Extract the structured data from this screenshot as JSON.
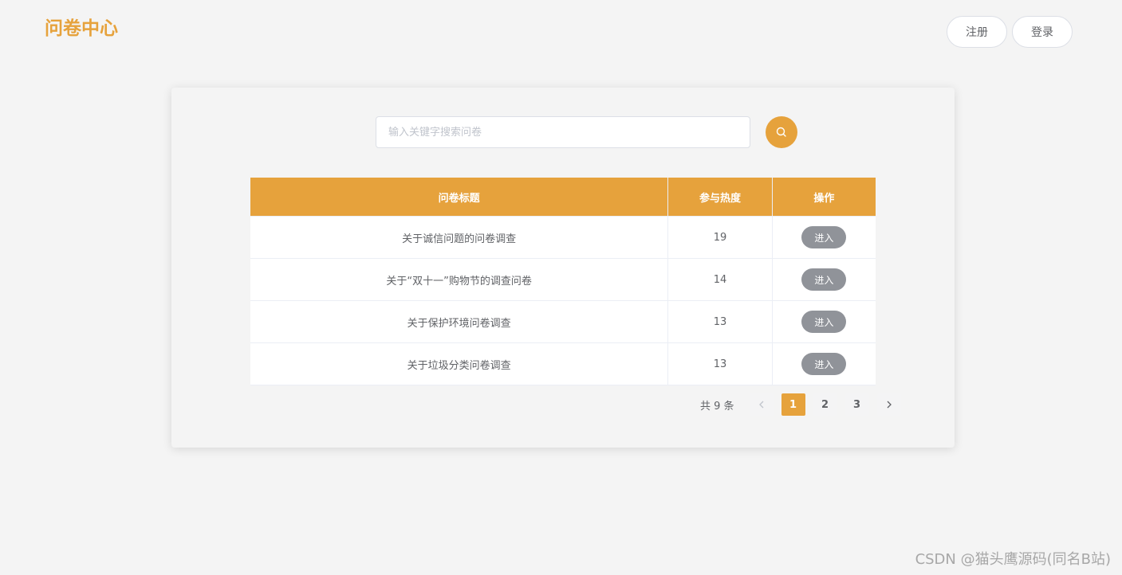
{
  "header": {
    "brand": "问卷中心",
    "register_label": "注册",
    "login_label": "登录"
  },
  "search": {
    "placeholder": "输入关键字搜索问卷",
    "value": "",
    "button_icon": "search-icon"
  },
  "table": {
    "columns": [
      "问卷标题",
      "参与热度",
      "操作"
    ],
    "rows": [
      {
        "title": "关于诚信问题的问卷调查",
        "heat": "19",
        "action": "进入"
      },
      {
        "title": "关于“双十一”购物节的调查问卷",
        "heat": "14",
        "action": "进入"
      },
      {
        "title": "关于保护环境问卷调查",
        "heat": "13",
        "action": "进入"
      },
      {
        "title": "关于垃圾分类问卷调查",
        "heat": "13",
        "action": "进入"
      }
    ]
  },
  "pagination": {
    "total_label": "共 9 条",
    "pages": [
      "1",
      "2",
      "3"
    ],
    "current_page": "1",
    "prev_icon": "chevron-left-icon",
    "next_icon": "chevron-right-icon"
  },
  "watermark": "CSDN @猫头鹰源码(同名B站)",
  "colors": {
    "accent": "#e6a23c",
    "button_gray": "#909399",
    "background": "#f4f4f4"
  }
}
